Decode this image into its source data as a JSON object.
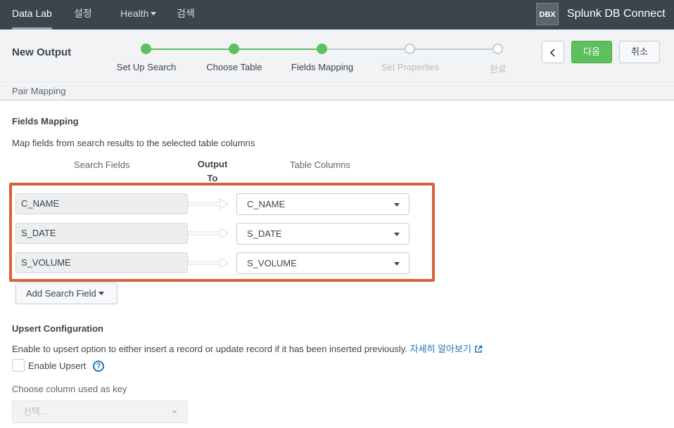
{
  "nav": {
    "items": [
      {
        "label": "Data Lab"
      },
      {
        "label": "설정"
      },
      {
        "label": "Health"
      },
      {
        "label": "검색"
      }
    ],
    "badge": "DBX",
    "app_name": "Splunk DB Connect"
  },
  "header": {
    "title": "New Output",
    "steps": [
      {
        "label": "Set Up Search",
        "status": "done"
      },
      {
        "label": "Choose Table",
        "status": "done"
      },
      {
        "label": "Fields Mapping",
        "status": "done"
      },
      {
        "label": "Set Properties",
        "status": "todo"
      },
      {
        "label": "완료",
        "status": "todo"
      }
    ],
    "back_icon": "chevron-left-icon",
    "next_label": "다음",
    "cancel_label": "취소"
  },
  "subheader": {
    "label": "Pair Mapping"
  },
  "fields_mapping": {
    "title": "Fields Mapping",
    "description": "Map fields from search results to the selected table columns",
    "col_search_fields": "Search Fields",
    "col_output_to": "Output To",
    "col_table_columns": "Table Columns",
    "rows": [
      {
        "search_field": "C_NAME",
        "table_column": "C_NAME"
      },
      {
        "search_field": "S_DATE",
        "table_column": "S_DATE"
      },
      {
        "search_field": "S_VOLUME",
        "table_column": "S_VOLUME"
      }
    ],
    "add_button": "Add Search Field"
  },
  "upsert": {
    "title": "Upsert Configuration",
    "description": "Enable to upsert option to either insert a record or update record if it has been inserted previously.",
    "learn_more": "자세히 알아보기",
    "enable_label": "Enable Upsert",
    "enabled": false,
    "key_label": "Choose column used as key",
    "key_placeholder": "선택..."
  },
  "colors": {
    "nav_bg": "#3c444d",
    "accent_green": "#5cc05c",
    "highlight": "#d9603b",
    "link": "#1a73b8"
  }
}
